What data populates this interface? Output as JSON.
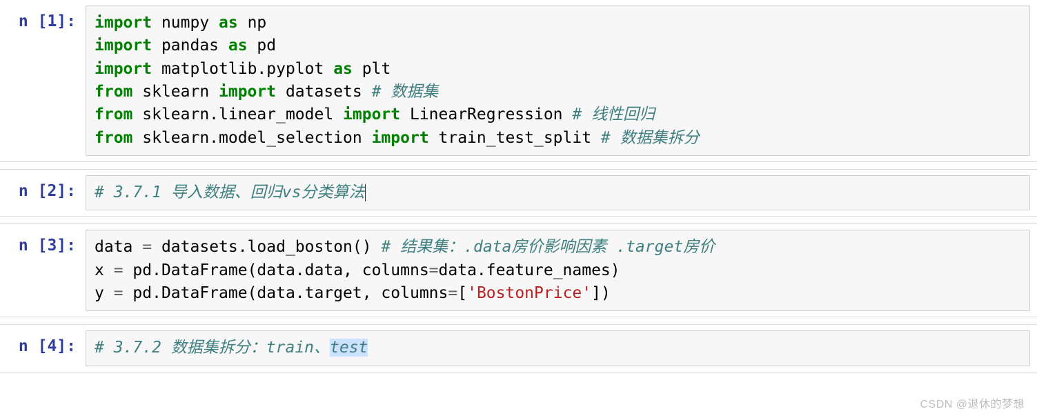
{
  "cells": [
    {
      "prompt": "n [1]:",
      "lines": [
        [
          {
            "cls": "kw",
            "t": "import"
          },
          {
            "cls": "nm",
            "t": " numpy "
          },
          {
            "cls": "kw",
            "t": "as"
          },
          {
            "cls": "nm",
            "t": " np"
          }
        ],
        [
          {
            "cls": "kw",
            "t": "import"
          },
          {
            "cls": "nm",
            "t": " pandas "
          },
          {
            "cls": "kw",
            "t": "as"
          },
          {
            "cls": "nm",
            "t": " pd"
          }
        ],
        [
          {
            "cls": "kw",
            "t": "import"
          },
          {
            "cls": "nm",
            "t": " matplotlib.pyplot "
          },
          {
            "cls": "kw",
            "t": "as"
          },
          {
            "cls": "nm",
            "t": " plt"
          }
        ],
        [
          {
            "cls": "kw",
            "t": "from"
          },
          {
            "cls": "nm",
            "t": " sklearn "
          },
          {
            "cls": "kw",
            "t": "import"
          },
          {
            "cls": "nm",
            "t": " datasets "
          },
          {
            "cls": "cm",
            "t": "# 数据集"
          }
        ],
        [
          {
            "cls": "kw",
            "t": "from"
          },
          {
            "cls": "nm",
            "t": " sklearn.linear_model "
          },
          {
            "cls": "kw",
            "t": "import"
          },
          {
            "cls": "nm",
            "t": " LinearRegression "
          },
          {
            "cls": "cm",
            "t": "# 线性回归"
          }
        ],
        [
          {
            "cls": "kw",
            "t": "from"
          },
          {
            "cls": "nm",
            "t": " sklearn.model_selection "
          },
          {
            "cls": "kw",
            "t": "import"
          },
          {
            "cls": "nm",
            "t": " train_test_split "
          },
          {
            "cls": "cm",
            "t": "# 数据集拆分"
          }
        ]
      ]
    },
    {
      "prompt": "n [2]:",
      "lines": [
        [
          {
            "cls": "cm",
            "t": "# 3.7.1 导入数据、回归vs分类算法"
          },
          {
            "cls": "cursor",
            "t": ""
          }
        ]
      ]
    },
    {
      "prompt": "n [3]:",
      "lines": [
        [
          {
            "cls": "nm",
            "t": "data "
          },
          {
            "cls": "op",
            "t": "="
          },
          {
            "cls": "nm",
            "t": " datasets.load_boston() "
          },
          {
            "cls": "cm",
            "t": "# 结果集：.data房价影响因素 .target房价"
          }
        ],
        [
          {
            "cls": "nm",
            "t": "x "
          },
          {
            "cls": "op",
            "t": "="
          },
          {
            "cls": "nm",
            "t": " pd.DataFrame(data.data, columns"
          },
          {
            "cls": "op",
            "t": "="
          },
          {
            "cls": "nm",
            "t": "data.feature_names)"
          }
        ],
        [
          {
            "cls": "nm",
            "t": "y "
          },
          {
            "cls": "op",
            "t": "="
          },
          {
            "cls": "nm",
            "t": " pd.DataFrame(data.target, columns"
          },
          {
            "cls": "op",
            "t": "="
          },
          {
            "cls": "nm",
            "t": "["
          },
          {
            "cls": "str",
            "t": "'BostonPrice'"
          },
          {
            "cls": "nm",
            "t": "])"
          }
        ]
      ]
    },
    {
      "prompt": "n [4]:",
      "lines": [
        [
          {
            "cls": "cm",
            "t": "# 3.7.2 数据集拆分：train、"
          },
          {
            "cls": "cm sel",
            "t": "test"
          }
        ]
      ]
    }
  ],
  "watermark": "CSDN @退休的梦想"
}
